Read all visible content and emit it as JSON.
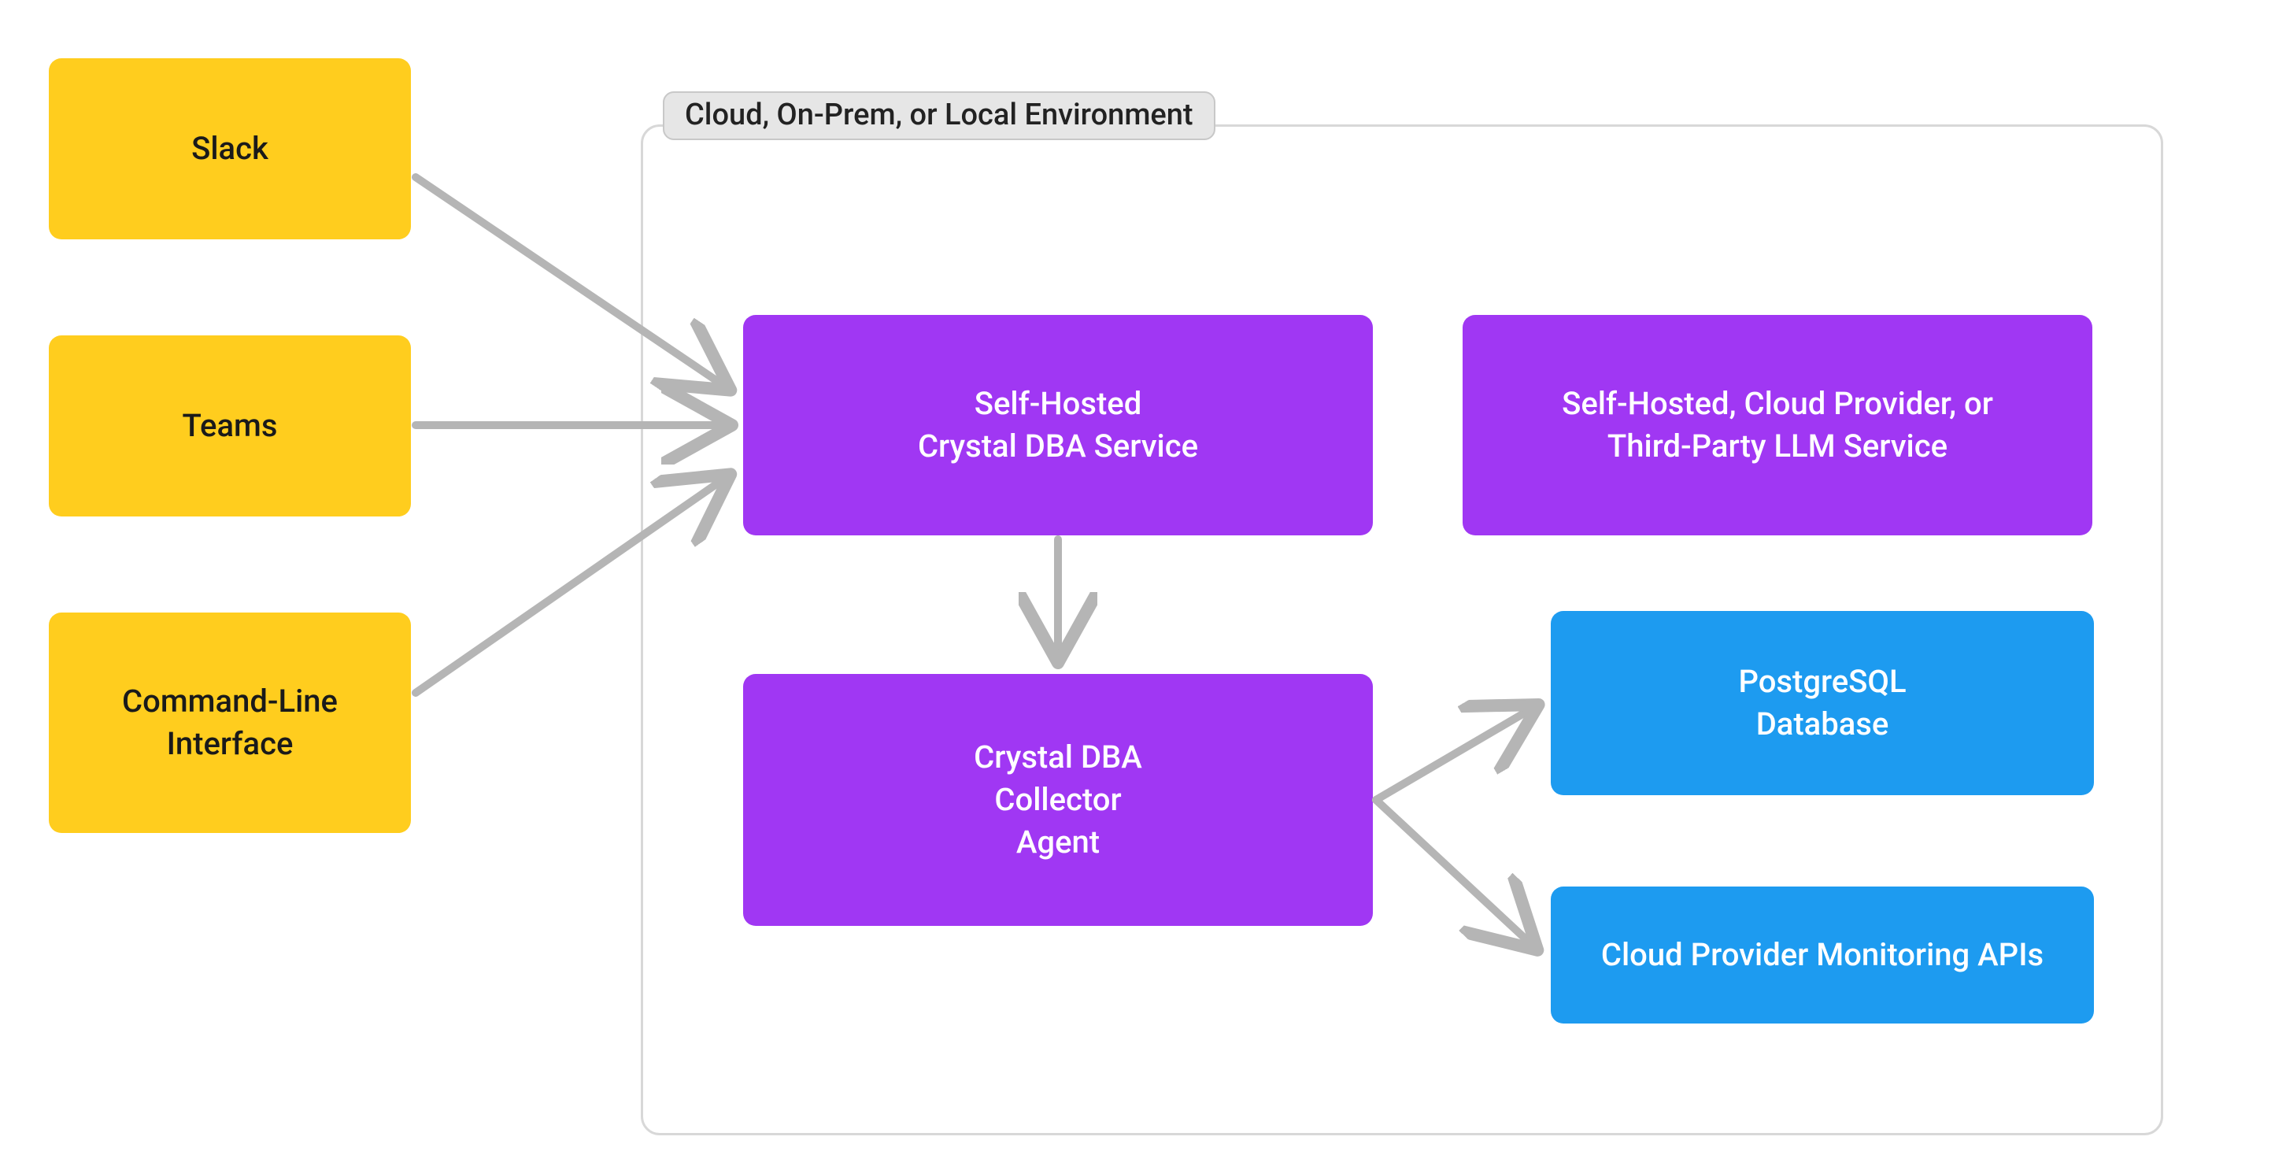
{
  "env": {
    "label": "Cloud, On-Prem, or Local Environment"
  },
  "clients": {
    "slack": "Slack",
    "teams": "Teams",
    "cli_line1": "Command-Line",
    "cli_line2": "Interface"
  },
  "services": {
    "dba_service_line1": "Self-Hosted",
    "dba_service_line2": "Crystal DBA Service",
    "collector_line1": "Crystal DBA",
    "collector_line2": "Collector",
    "collector_line3": "Agent",
    "llm_line1": "Self-Hosted, Cloud Provider, or",
    "llm_line2": "Third-Party LLM Service",
    "postgres_line1": "PostgreSQL",
    "postgres_line2": "Database",
    "monitoring": "Cloud Provider Monitoring APIs"
  }
}
